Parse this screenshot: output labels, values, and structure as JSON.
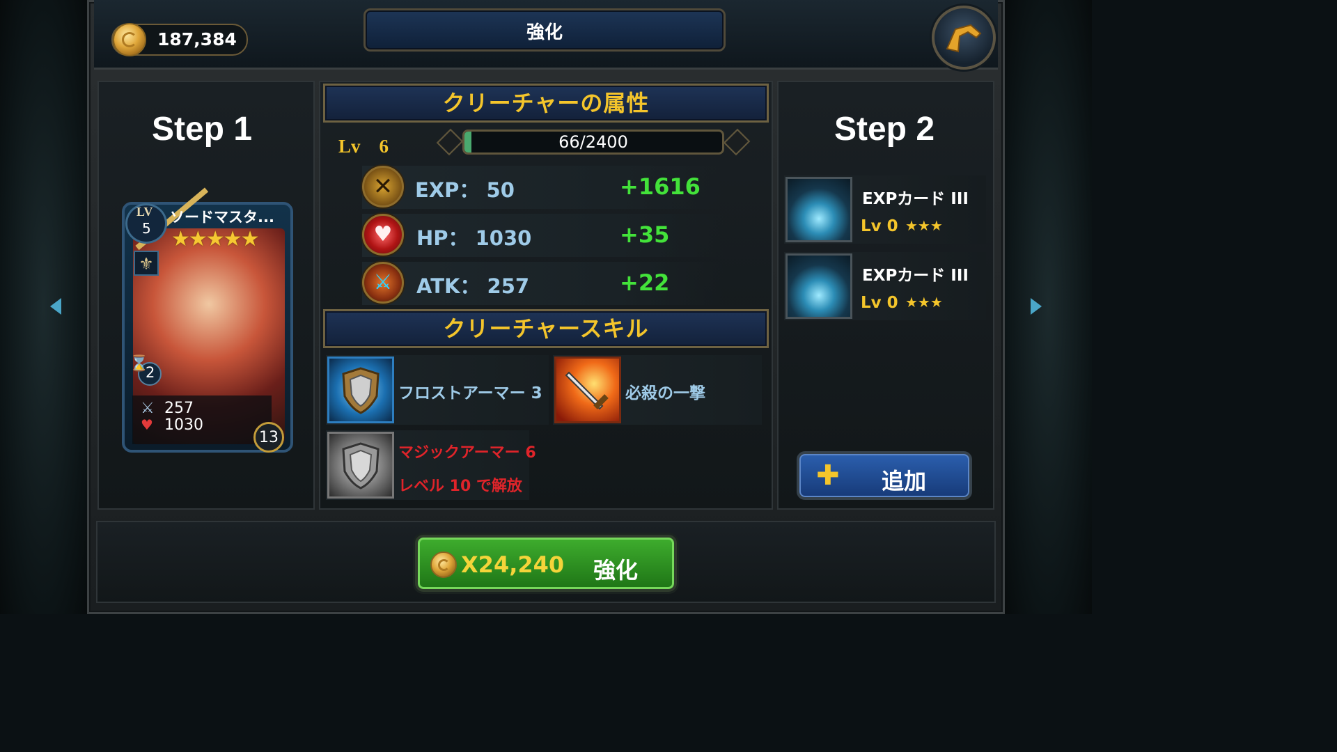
{
  "topbar": {
    "coins": "187,384",
    "title": "強化"
  },
  "step1": {
    "label": "Step 1"
  },
  "step2": {
    "label": "Step 2"
  },
  "card": {
    "lv_label": "LV",
    "level": "5",
    "name": "ソードマスタ...",
    "stars": "★★★★★",
    "cost": "2",
    "atk": "257",
    "hp": "1030",
    "rank": "13"
  },
  "attributes": {
    "header": "クリーチャーの属性",
    "level_label": "Lv　6",
    "exp_progress": "66/2400",
    "exp_fraction": 0.0275,
    "rows": [
      {
        "label": "EXP：  50",
        "plus": "+1616",
        "icon": "exp-icon"
      },
      {
        "label": "HP：  1030",
        "plus": "+35",
        "icon": "heart-icon"
      },
      {
        "label": "ATK：  257",
        "plus": "+22",
        "icon": "attack-icon"
      }
    ]
  },
  "skills": {
    "header": "クリーチャースキル",
    "items": [
      {
        "name": "フロストアーマー 3"
      },
      {
        "name": "必殺の一撃"
      },
      {
        "name": "マジックアーマー 6",
        "locked_note": "レベル 10 で解放"
      }
    ]
  },
  "materials": [
    {
      "name": "EXPカード III",
      "level": "Lv 0",
      "stars": "★★★"
    },
    {
      "name": "EXPカード III",
      "level": "Lv 0",
      "stars": "★★★"
    }
  ],
  "buttons": {
    "add": "追加",
    "enhance_cost": "X24,240",
    "enhance": "強化"
  },
  "colors": {
    "accent_gold": "#f4c52b",
    "plus_green": "#43e23a",
    "locked_red": "#e0242a",
    "stat_blue": "#9fcbe8"
  }
}
